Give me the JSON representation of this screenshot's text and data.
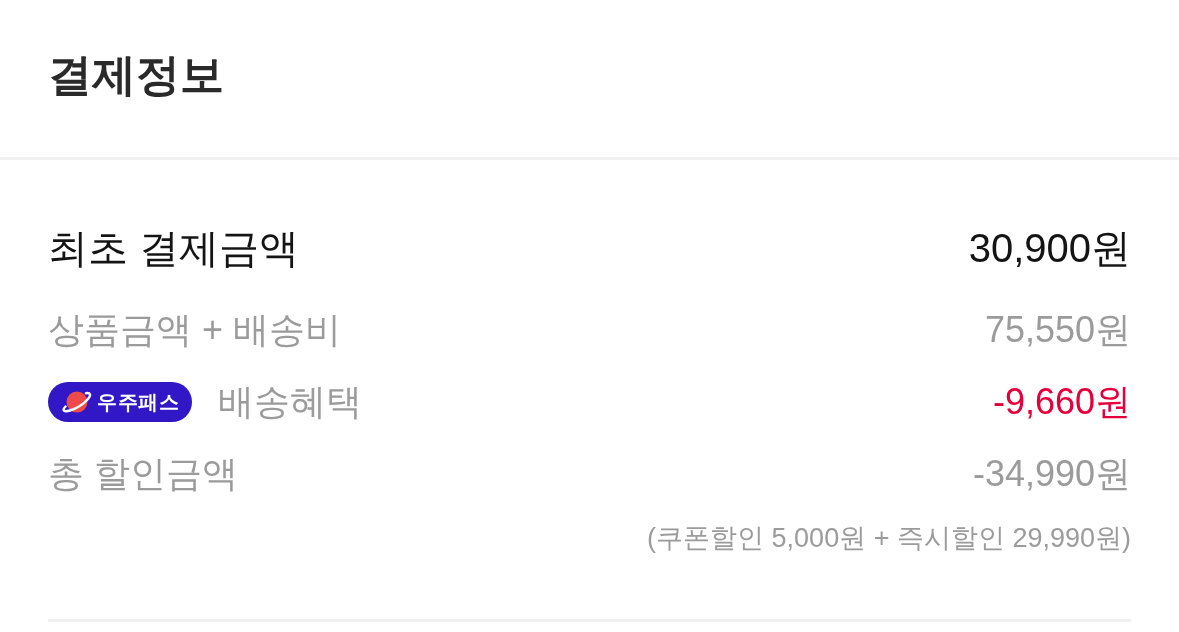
{
  "header": {
    "title": "결제정보"
  },
  "summary": {
    "rows": [
      {
        "kind": "total",
        "label": "최초 결제금액",
        "amount": "30,900원"
      },
      {
        "kind": "item",
        "label": "상품금액 + 배송비",
        "amount": "75,550원"
      },
      {
        "kind": "benefit",
        "badge": "우주패스",
        "label": "배송혜택",
        "amount": "-9,660원"
      },
      {
        "kind": "item",
        "label": "총 할인금액",
        "amount": "-34,990원",
        "note": "(쿠폰할인 5,000원 + 즉시할인 29,990원)"
      }
    ]
  }
}
